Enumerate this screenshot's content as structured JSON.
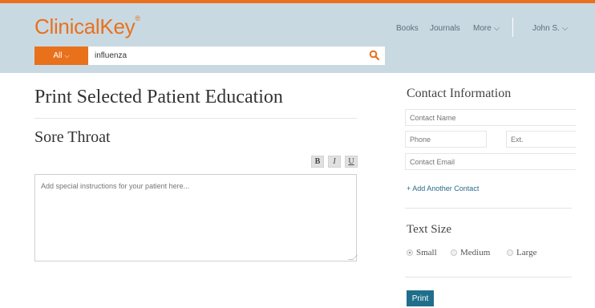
{
  "header": {
    "logo_text": "ClinicalKey",
    "logo_mark": "®",
    "search": {
      "scope_label": "All",
      "value": "influenza"
    },
    "nav": {
      "books": "Books",
      "journals": "Journals",
      "more": "More",
      "user": "John S."
    }
  },
  "main": {
    "page_title": "Print Selected Patient Education",
    "section_title": "Sore Throat",
    "format_buttons": {
      "bold": "B",
      "italic": "I",
      "underline": "U"
    },
    "instructions_placeholder": "Add special instructions for your patient here..."
  },
  "sidebar": {
    "contact_title": "Contact Information",
    "contact_name_placeholder": "Contact Name",
    "phone_placeholder": "Phone",
    "ext_placeholder": "Ext.",
    "email_placeholder": "Contact Email",
    "add_contact": "+ Add Another Contact",
    "text_size_title": "Text Size",
    "text_size_options": [
      "Small",
      "Medium",
      "Large"
    ],
    "text_size_selected": "Small",
    "print_label": "Print"
  },
  "colors": {
    "brand_orange": "#e9711c",
    "header_bg": "#c9d9e2",
    "print_button": "#1f6f8b",
    "link": "#2a6a8a"
  }
}
